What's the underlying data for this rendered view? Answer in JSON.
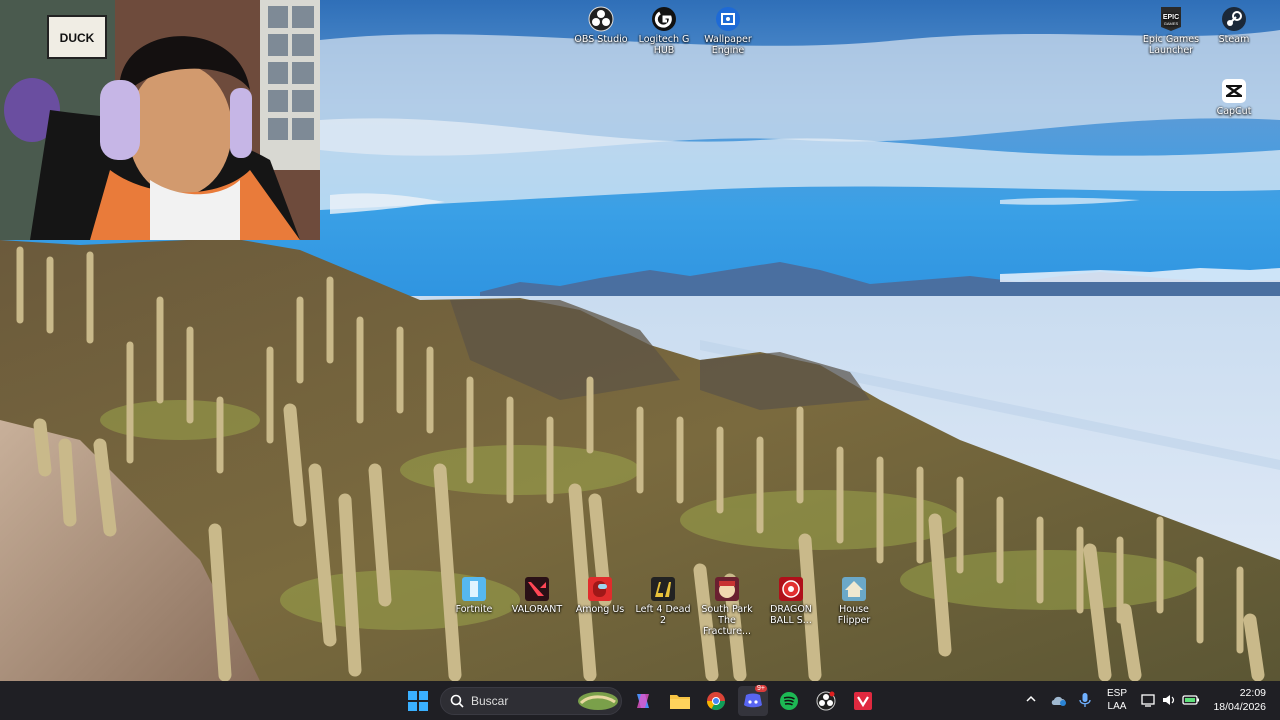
{
  "desktop_icons": [
    {
      "label": "OBS Studio",
      "icon": "obs-icon"
    },
    {
      "label": "Logitech G HUB",
      "icon": "logitech-icon"
    },
    {
      "label": "Wallpaper Engine",
      "icon": "wallpaper-engine-icon"
    },
    {
      "label": "Epic Games Launcher",
      "icon": "epic-games-icon"
    },
    {
      "label": "Steam",
      "icon": "steam-icon"
    },
    {
      "label": "CapCut",
      "icon": "capcut-icon"
    },
    {
      "label": "Fortnite",
      "icon": "fortnite-icon"
    },
    {
      "label": "VALORANT",
      "icon": "valorant-icon"
    },
    {
      "label": "Among Us",
      "icon": "among-us-icon"
    },
    {
      "label": "Left 4 Dead 2",
      "icon": "left4dead2-icon"
    },
    {
      "label": "South Park The Fracture...",
      "icon": "south-park-icon"
    },
    {
      "label": "DRAGON BALL S...",
      "icon": "dragon-ball-icon"
    },
    {
      "label": "House Flipper",
      "icon": "house-flipper-icon"
    }
  ],
  "webcam": {
    "sign": "DUCK"
  },
  "taskbar": {
    "search_placeholder": "Buscar",
    "discord_badge": "9+",
    "language": "ESP",
    "layout": "LAA",
    "time": "22:09",
    "date": "18/04/2026"
  }
}
